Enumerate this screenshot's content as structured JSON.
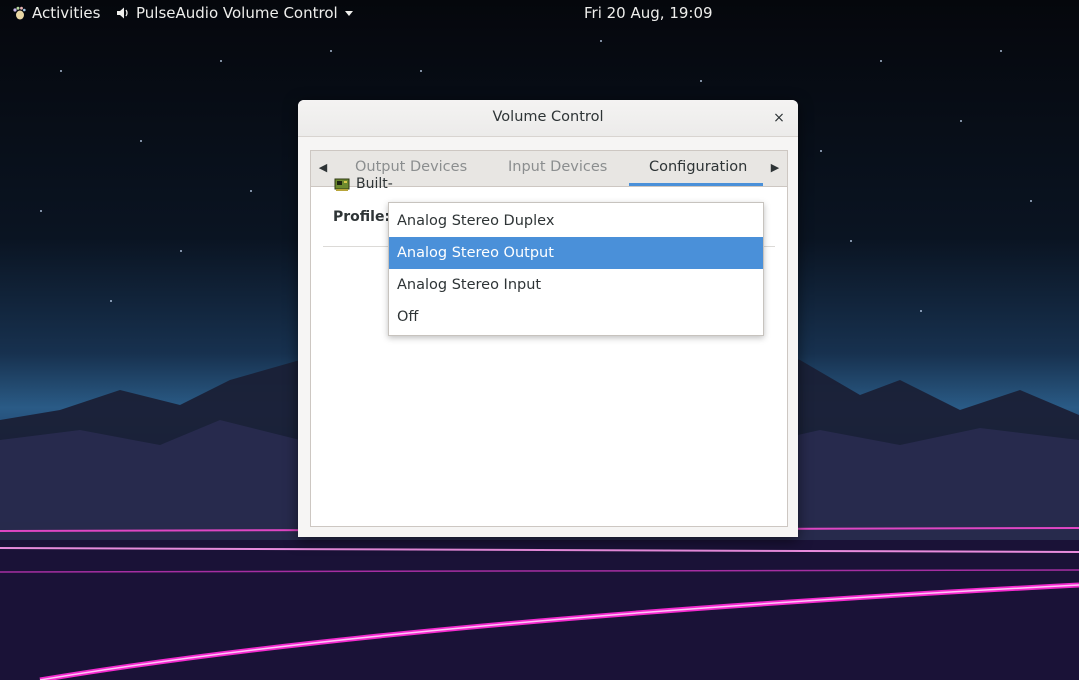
{
  "topbar": {
    "activities_label": "Activities",
    "app_label": "PulseAudio Volume Control",
    "clock": "Fri 20 Aug, 19:09"
  },
  "window": {
    "title": "Volume Control",
    "close_glyph": "×",
    "tabs": [
      {
        "label": "Output Devices",
        "active": false
      },
      {
        "label": "Input Devices",
        "active": false
      },
      {
        "label": "Configuration",
        "active": true
      }
    ],
    "card_name": "Built-",
    "profile_label": "Profile:"
  },
  "profile_menu": {
    "items": [
      {
        "label": "Analog Stereo Duplex",
        "selected": false
      },
      {
        "label": "Analog Stereo Output",
        "selected": true
      },
      {
        "label": "Analog Stereo Input",
        "selected": false
      },
      {
        "label": "Off",
        "selected": false
      }
    ]
  },
  "colors": {
    "accent": "#4a90d9",
    "window_bg": "#f6f5f4",
    "neon_pink": "#ff2bd6"
  },
  "icons": {
    "activities": "gnome-foot-icon",
    "app": "speaker-icon",
    "app_menu": "caret-down-icon",
    "tab_prev": "arrow-left-icon",
    "tab_next": "arrow-right-icon",
    "card": "sound-card-icon"
  }
}
